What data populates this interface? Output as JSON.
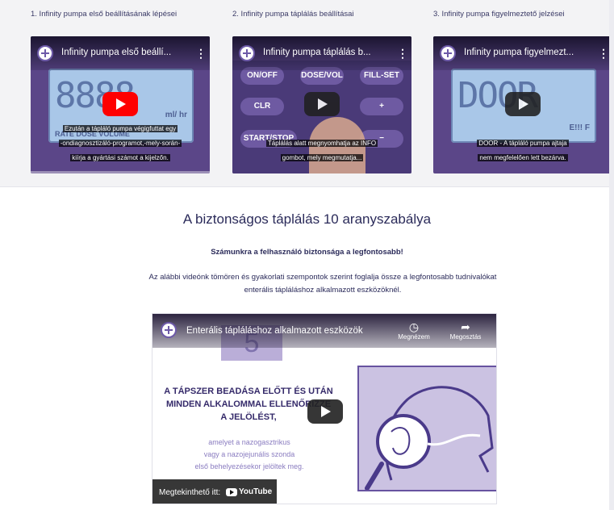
{
  "cards": [
    {
      "heading": "1. Infinity pumpa első beállításának lépései",
      "video_title": "Infinity pumpa első beállí...",
      "screen_text": "8888",
      "screen_small": "RATE DOSE VOLUME",
      "screen_unit": "ml/ hr",
      "caption_lines": [
        "Ezután a tápláló pumpa végigfuttat egy",
        "-ondiagnosztizáló-programot,-mely-során-",
        "kiírja a gyártási számot a kijelzőn."
      ]
    },
    {
      "heading": "2. Infinity pumpa táplálás beállításai",
      "video_title": "Infinity pumpa táplálás b...",
      "keys": [
        "ON/OFF",
        "DOSE/VOL",
        "FILL-SET",
        "CLR",
        "+",
        "START/STOP",
        "−"
      ],
      "caption_lines": [
        "Táplálás alatt megnyomhatja az INFO",
        "gombot, mely megmutatja..."
      ]
    },
    {
      "heading": "3. Infinity pumpa figyelmeztető jelzései",
      "video_title": "Infinity pumpa figyelmezt...",
      "screen_text": "DOOR",
      "screen_unit": "E!!! F",
      "caption_lines": [
        "DOOR - A tápláló pumpa ajtaja",
        "nem megfelelően lett bezárva."
      ]
    }
  ],
  "section": {
    "title": "A biztonságos táplálás 10 aranyszabálya",
    "subhead": "Számunkra a felhasználó biztonsága a legfontosabb!",
    "intro": "Az alábbi videónk tömören és gyakorlati szempontok szerint foglalja össze a legfontosabb tudnivalókat enterális tápláláshoz alkalmazott eszközöknél."
  },
  "featured_video": {
    "title": "Enterális tápláláshoz alkalmazott eszközök",
    "later_label": "Megnézem",
    "share_label": "Megosztás",
    "number": "5",
    "main_text_1": "A TÁPSZER BEADÁSA ELŐTT ÉS UTÁN",
    "main_text_2": "MINDEN ALKALOMMAL ELLENŐRIZZE",
    "main_text_3": "A JELÖLÉST,",
    "sub_text_1": "amelyet a nazogasztrikus",
    "sub_text_2": "vagy a nazojejunális szonda",
    "sub_text_3": "első behelyezésekor jelöltek meg.",
    "watch_label": "Megtekinthető itt:",
    "yt_word": "YouTube"
  },
  "icons": {
    "channel": "channel-plus-icon",
    "play": "play-icon",
    "menu": "kebab-menu-icon",
    "clock": "clock-icon",
    "share": "share-arrow-icon",
    "youtube": "youtube-logo-icon"
  },
  "colors": {
    "brand_purple": "#5b4688",
    "youtube_red": "#ff0000",
    "text_navy": "#2b2b5a"
  }
}
